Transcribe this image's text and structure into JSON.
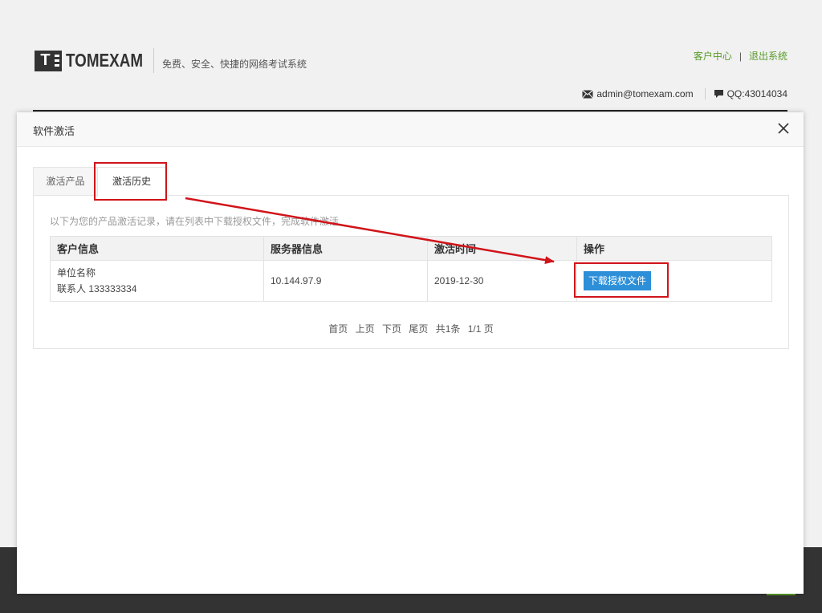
{
  "header": {
    "logo_text": "TOMEXAM",
    "logo_mark": "T",
    "slogan": "免费、安全、快捷的网络考试系统",
    "links": {
      "customer_center": "客户中心",
      "separator": "|",
      "logout": "退出系统"
    },
    "contact": {
      "email": "admin@tomexam.com",
      "qq": "QQ:43014034"
    }
  },
  "modal": {
    "title": "软件激活",
    "close_icon": "close-icon",
    "tabs": [
      {
        "label": "激活产品",
        "active": false
      },
      {
        "label": "激活历史",
        "active": true
      }
    ],
    "hint": "以下为您的产品激活记录，请在列表中下载授权文件，完成软件激活",
    "table": {
      "headers": [
        "客户信息",
        "服务器信息",
        "激活时间",
        "操作"
      ],
      "rows": [
        {
          "customer_name": "单位名称",
          "contact": "联系人 133333334",
          "server": "10.144.97.9",
          "date": "2019-12-30",
          "action_label": "下载授权文件"
        }
      ]
    },
    "pager": {
      "first": "首页",
      "prev": "上页",
      "next": "下页",
      "last": "尾页",
      "total": "共1条",
      "page": "1/1 页"
    }
  },
  "colors": {
    "accent_green": "#5a9a2b",
    "button_blue": "#2d8fd8",
    "annotation_red": "#d0141a",
    "footer_dark": "#333333"
  }
}
